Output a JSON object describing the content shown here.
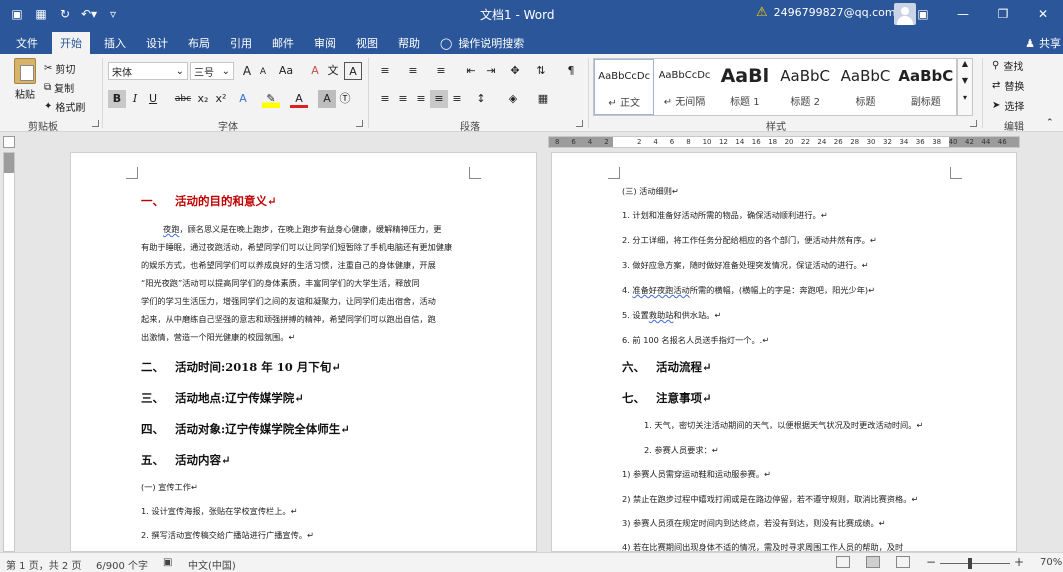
{
  "title_bar": {
    "doc_title": "文档1 - Word",
    "account": "2496799827@qq.com",
    "qat": [
      "save-icon",
      "save-as-icon",
      "redo-icon",
      "undo-icon",
      "customize-icon"
    ],
    "win_buttons": [
      "ribbon-display-icon",
      "minimize-icon",
      "restore-icon",
      "close-icon"
    ]
  },
  "tabs": [
    "文件",
    "开始",
    "插入",
    "设计",
    "布局",
    "引用",
    "邮件",
    "审阅",
    "视图",
    "帮助"
  ],
  "active_tab": "开始",
  "tell_me": "操作说明搜索",
  "share": "共享",
  "ribbon": {
    "clipboard": {
      "label": "剪贴板",
      "paste": "粘贴",
      "cut": "剪切",
      "copy": "复制",
      "format_painter": "格式刷"
    },
    "font": {
      "label": "字体",
      "name": "宋体",
      "size": "三号",
      "grow": "A",
      "shrink": "A",
      "change_case": "Aa",
      "clear": "A",
      "bold": "B",
      "italic": "I",
      "underline": "U",
      "strike": "abc",
      "sub": "x₂",
      "sup": "x²",
      "text_effect": "A",
      "font_color": "A",
      "shade": "A"
    },
    "paragraph": {
      "label": "段落"
    },
    "styles": {
      "label": "样式",
      "items": [
        {
          "preview": "AaBbCcDc",
          "name": "↵ 正文"
        },
        {
          "preview": "AaBbCcDc",
          "name": "↵ 无间隔"
        },
        {
          "preview": "AaBl",
          "name": "标题 1"
        },
        {
          "preview": "AaBbC",
          "name": "标题 2"
        },
        {
          "preview": "AaBbC",
          "name": "标题"
        },
        {
          "preview": "AaBbC",
          "name": "副标题"
        }
      ]
    },
    "editing": {
      "label": "编辑",
      "find": "查找",
      "replace": "替换",
      "select": "选择"
    }
  },
  "ruler_numbers": [
    "8",
    "6",
    "4",
    "2",
    "",
    "2",
    "4",
    "6",
    "8",
    "10",
    "12",
    "14",
    "16",
    "18",
    "20",
    "22",
    "24",
    "26",
    "28",
    "30",
    "32",
    "34",
    "36",
    "38",
    "40",
    "42",
    "44",
    "46"
  ],
  "left_page": {
    "h_purpose": {
      "num": "一、",
      "text": "活动的目的和意义↵"
    },
    "para_lines": [
      {
        "prefix": "",
        "wavy": "夜跑",
        "text": "，顾名思义是在晚上跑步，在晚上跑步有益身心健康，缓解精神压力，更"
      },
      {
        "text": "有助于睡眠，通过夜跑活动，希望同学们可以让同学们短暂除了手机电脑还有更加健康"
      },
      {
        "text": "的娱乐方式，也希望同学们可以养成良好的生活习惯，注重自己的身体健康，开展"
      },
      {
        "text": "“阳光夜跑”活动可以提高同学们的身体素质，丰富同学们的大学生活，释放同"
      },
      {
        "text": "学们的学习生活压力，增强同学们之间的友谊和凝聚力，让同学们走出宿舍，活动"
      },
      {
        "text": "起来，从中磨练自己坚强的意志和顽强拼搏的精神，希望同学们可以跑出自信，跑"
      },
      {
        "text": "出激情，营造一个阳光健康的校园氛围。↵"
      }
    ],
    "headings": [
      {
        "num": "二、",
        "text": "活动时间:2018 年 10 月下旬↵"
      },
      {
        "num": "三、",
        "text": "活动地点:辽宁传媒学院↵"
      },
      {
        "num": "四、",
        "text": "活动对象:辽宁传媒学院全体师生↵"
      },
      {
        "num": "五、",
        "text": "活动内容↵"
      }
    ],
    "sub": "(一)    宣传工作↵",
    "list": [
      "1.    设计宣传海报，张贴在学校宣传栏上。↵",
      "2.    撰写活动宣传稿交给广播站进行广播宣传。↵"
    ]
  },
  "right_page": {
    "sub": "(三)    活动细则↵",
    "list": [
      {
        "text": "1.    计划和准备好活动所需的物品，确保活动顺利进行。↵"
      },
      {
        "text": "2.    分工详细，将工作任务分配给相应的各个部门，便活动井然有序。↵"
      },
      {
        "text": "3.    做好应急方案，随时做好准备处理突发情况，保证活动的进行。↵"
      },
      {
        "pre": "4.    ",
        "wavy": "准备好夜跑活动",
        "text": "所需的横幅，(横幅上的字是：奔跑吧，阳光少年)↵"
      },
      {
        "pre": "5.    设置",
        "wavy": "救助站",
        "text": "和供水站。↵"
      },
      {
        "text": "6.    前 100 名报名人员送手指灯一个。.↵"
      }
    ],
    "h_flow": {
      "num": "六、",
      "text": "活动流程↵"
    },
    "h_notes": {
      "num": "七、",
      "text": "注意事项↵"
    },
    "notes": [
      "1. 天气，密切关注活动期间的天气，以便根据天气状况及时更改活动时间。↵",
      "2. 参赛人员要求：↵"
    ],
    "rules": [
      "1)    参赛人员需穿运动鞋和运动服参赛。↵",
      "2)    禁止在跑步过程中嬉戏打闹或是在路边停留，若不遵守规则，取消比赛资格。↵",
      "3)    参赛人员须在规定时间内到达终点，若没有到达，则没有比赛成绩。↵",
      "4)    若在比赛期间出现身体不适的情况，需及时寻求周围工作人员的帮助，及时"
    ]
  },
  "status_bar": {
    "page": "第 1 页，共 2 页",
    "words": "6/900 个字",
    "lang": "中文(中国)",
    "zoom": "70%"
  }
}
